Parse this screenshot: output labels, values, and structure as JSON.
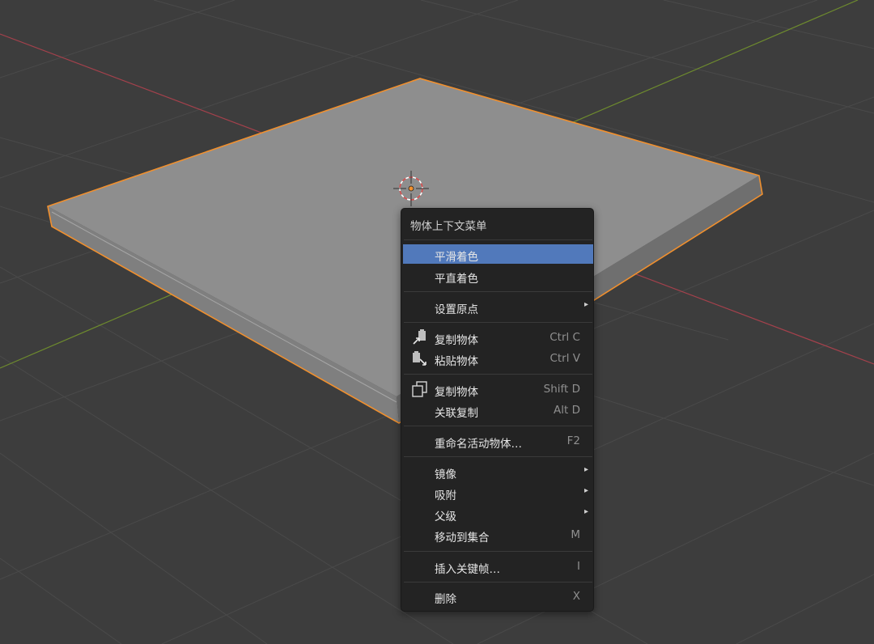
{
  "colors": {
    "background": "#3d3d3d",
    "grid": "#4a4a4a",
    "x_axis": "#a4414c",
    "y_axis": "#6e8b2e",
    "object_top": "#8e8e8e",
    "object_side": "#7a7a7a",
    "selection_outline": "#f1902e",
    "menu_background": "#232323",
    "menu_highlight": "#5179bb"
  },
  "context_menu": {
    "title": "物体上下文菜单",
    "items": [
      {
        "label": "平滑着色",
        "shortcut": "",
        "icon": "",
        "highlighted": true
      },
      {
        "label": "平直着色",
        "shortcut": "",
        "icon": ""
      },
      {
        "label": "设置原点",
        "shortcut": "",
        "submenu": "▸"
      },
      {
        "label": "复制物体",
        "shortcut": "Ctrl C",
        "icon": "copy-to-buffer-icon"
      },
      {
        "label": "粘贴物体",
        "shortcut": "Ctrl V",
        "icon": "paste-from-buffer-icon"
      },
      {
        "label": "复制物体",
        "shortcut": "Shift D",
        "icon": "duplicate-icon"
      },
      {
        "label": "关联复制",
        "shortcut": "Alt D",
        "icon": ""
      },
      {
        "label": "重命名活动物体…",
        "shortcut": "F2",
        "icon": ""
      },
      {
        "label": "镜像",
        "shortcut": "",
        "submenu": "▸"
      },
      {
        "label": "吸附",
        "shortcut": "",
        "submenu": "▸"
      },
      {
        "label": "父级",
        "shortcut": "",
        "submenu": "▸"
      },
      {
        "label": "移动到集合",
        "shortcut": "M",
        "icon": ""
      },
      {
        "label": "插入关键帧…",
        "shortcut": "I",
        "icon": ""
      },
      {
        "label": "删除",
        "shortcut": "X",
        "icon": ""
      }
    ]
  }
}
